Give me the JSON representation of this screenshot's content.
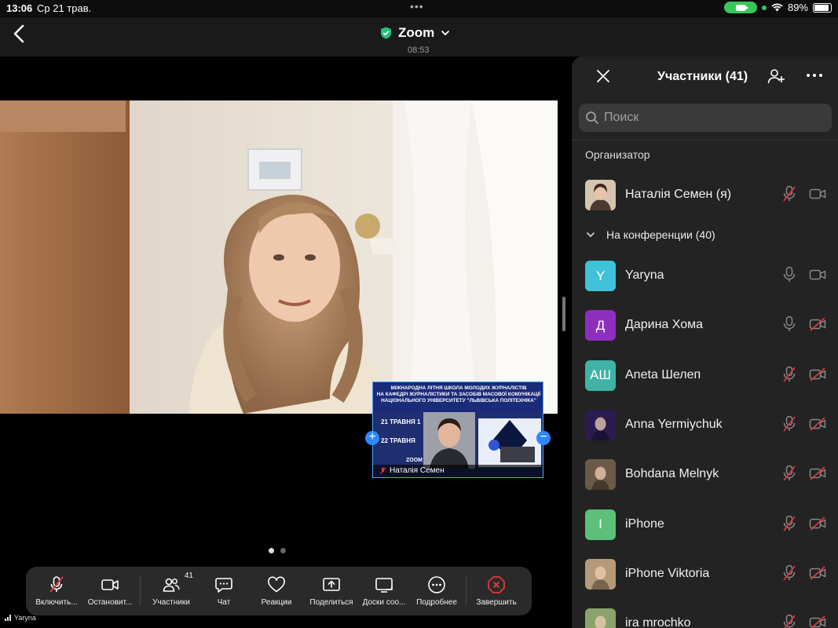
{
  "status_bar": {
    "time": "13:06",
    "date": "Ср 21 трав.",
    "battery": "89%",
    "battery_level": 0.89
  },
  "meeting": {
    "title": "Zoom",
    "timer": "08:53"
  },
  "pip": {
    "banner_lines": [
      "МІЖНАРОДНА ЛІТНЯ ШКОЛА МОЛОДИХ ЖУРНАЛІСТІВ",
      "НА КАФЕДРІ ЖУРНАЛІСТИКИ ТА ЗАСОБІВ МАСОВОЇ КОМУНІКАЦІЇ",
      "НАЦІОНАЛЬНОГО УНІВЕРСИТЕТУ \"ЛЬВІВСЬКА ПОЛІТЕХНІКА\""
    ],
    "date1": "21 ТРАВНЯ 1",
    "date2": "22 ТРАВНЯ",
    "zoom_text": "ZOOM",
    "name": "Наталія Семен"
  },
  "toolbar": {
    "unmute": "Включить...",
    "stop_video": "Остановит...",
    "participants": "Участники",
    "participants_count": "41",
    "chat": "Чат",
    "reactions": "Реакции",
    "share": "Поделиться",
    "whiteboards": "Доски соо...",
    "more": "Подробнее",
    "end": "Завершить"
  },
  "device_name": "Yaryna",
  "panel": {
    "title": "Участники (41)",
    "search_placeholder": "Поиск",
    "section_host": "Организатор",
    "section_in_meeting": "На конференции (40)",
    "host": {
      "name": "Наталія Семен (я)",
      "mic": "muted",
      "cam": "on"
    },
    "participants": [
      {
        "name": "Yaryna",
        "initials": "Y",
        "color": "#3fc2d8",
        "mic": "on",
        "cam": "on"
      },
      {
        "name": "Дарина Хома",
        "initials": "Д",
        "color": "#8e2ec0",
        "mic": "on",
        "cam": "off"
      },
      {
        "name": "Aneta Шелеп",
        "initials": "АШ",
        "color": "#3fb3a5",
        "mic": "muted",
        "cam": "off"
      },
      {
        "name": "Anna Yermiychuk",
        "initials": "",
        "color": "#2a1c50",
        "mic": "muted",
        "cam": "off"
      },
      {
        "name": "Bohdana Melnyk",
        "initials": "",
        "color": "#6b5a48",
        "mic": "muted",
        "cam": "off"
      },
      {
        "name": "iPhone",
        "initials": "I",
        "color": "#5cc07a",
        "mic": "muted",
        "cam": "off"
      },
      {
        "name": "iPhone Viktoria",
        "initials": "",
        "color": "#b59a7a",
        "mic": "muted",
        "cam": "off"
      },
      {
        "name": "ira mrochko",
        "initials": "",
        "color": "#8aa36a",
        "mic": "muted",
        "cam": "off"
      }
    ]
  },
  "colors": {
    "panel_bg": "#232323",
    "muted_red": "#e0383e",
    "accent_blue": "#2f88ff",
    "shield_green": "#27c07a"
  }
}
